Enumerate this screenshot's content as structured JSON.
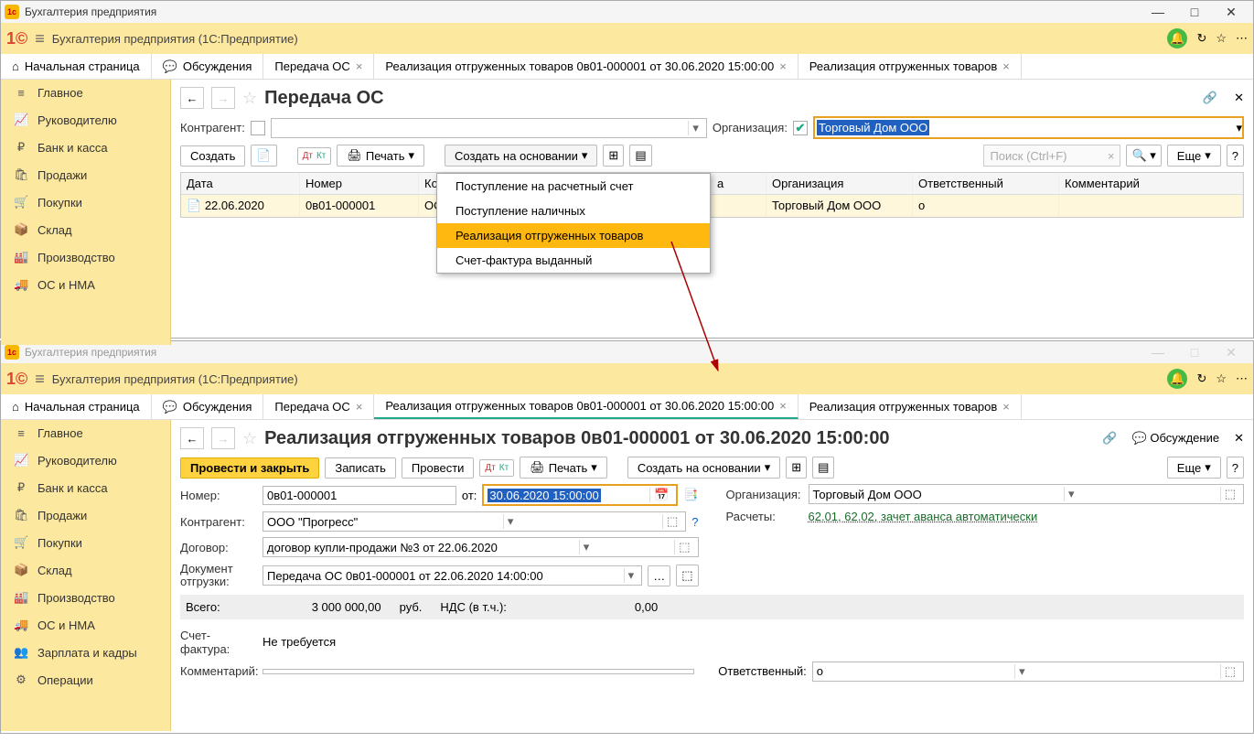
{
  "win1": {
    "title": "Бухгалтерия предприятия",
    "app": "Бухгалтерия предприятия  (1С:Предприятие)",
    "tabs": [
      "Начальная страница",
      "Обсуждения",
      "Передача ОС",
      "Реализация отгруженных товаров 0в01-000001 от 30.06.2020 15:00:00",
      "Реализация отгруженных товаров"
    ],
    "nav": [
      "Главное",
      "Руководителю",
      "Банк и касса",
      "Продажи",
      "Покупки",
      "Склад",
      "Производство",
      "ОС и НМА"
    ],
    "page_title": "Передача ОС",
    "filt_counter": "Контрагент:",
    "filt_org": "Организация:",
    "org_value": "Торговый Дом ООО",
    "btn_create": "Создать",
    "btn_print": "Печать",
    "btn_based": "Создать на основании",
    "btn_more": "Еще",
    "search_ph": "Поиск (Ctrl+F)",
    "cols": {
      "date": "Дата",
      "num": "Номер",
      "org_short": "Ко",
      "a": "а",
      "org": "Организация",
      "resp": "Ответственный",
      "comm": "Комментарий"
    },
    "row": {
      "date": "22.06.2020",
      "num": "0в01-000001",
      "kont": "ОС",
      "org": "Торговый Дом ООО",
      "resp": "о"
    },
    "menu": [
      "Поступление на расчетный счет",
      "Поступление наличных",
      "Реализация отгруженных товаров",
      "Счет-фактура выданный"
    ]
  },
  "win2": {
    "title": "Бухгалтерия предприятия",
    "page_title": "Реализация отгруженных товаров 0в01-000001 от 30.06.2020 15:00:00",
    "btn_post_close": "Провести и закрыть",
    "btn_save": "Записать",
    "btn_post": "Провести",
    "btn_print": "Печать",
    "btn_based": "Создать на основании",
    "btn_more": "Еще",
    "btn_discuss": "Обсуждение",
    "lbl_num": "Номер:",
    "num": "0в01-000001",
    "lbl_from": "от:",
    "date": "30.06.2020 15:00:00",
    "lbl_org": "Организация:",
    "org": "Торговый Дом ООО",
    "lbl_counter": "Контрагент:",
    "counter": "ООО \"Прогресс\"",
    "lbl_settle": "Расчеты:",
    "settle": "62.01, 62.02, зачет аванса автоматически",
    "lbl_contract": "Договор:",
    "contract": "договор купли-продажи №3 от 22.06.2020",
    "lbl_ship": "Документ отгрузки:",
    "ship": "Передача ОС 0в01-000001 от 22.06.2020 14:00:00",
    "lbl_total": "Всего:",
    "total": "3 000 000,00",
    "cur": "руб.",
    "lbl_vat": "НДС (в т.ч.):",
    "vat": "0,00",
    "lbl_invoice": "Счет-фактура:",
    "invoice": "Не требуется",
    "lbl_comment": "Комментарий:",
    "lbl_resp": "Ответственный:",
    "resp": "о",
    "nav_extra": [
      "Зарплата и кадры",
      "Операции"
    ]
  }
}
